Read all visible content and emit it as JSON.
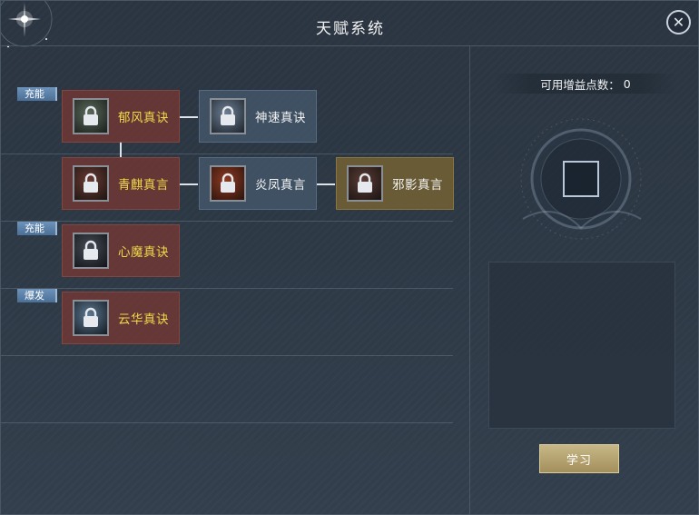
{
  "window": {
    "title": "天赋系统"
  },
  "tags": [
    {
      "label": "充能"
    },
    {
      "label": "充能"
    },
    {
      "label": "爆发"
    }
  ],
  "nodes": [
    {
      "label": "郁风真诀",
      "style": "red",
      "icon": "wind-skill-icon"
    },
    {
      "label": "神速真诀",
      "style": "blue",
      "icon": "speed-skill-icon"
    },
    {
      "label": "青麒真言",
      "style": "red",
      "icon": "qilin-skill-icon"
    },
    {
      "label": "炎凤真言",
      "style": "blue",
      "icon": "phoenix-skill-icon"
    },
    {
      "label": "邪影真言",
      "style": "gold",
      "icon": "shadow-skill-icon"
    },
    {
      "label": "心魔真诀",
      "style": "red",
      "icon": "demon-skill-icon"
    },
    {
      "label": "云华真诀",
      "style": "red",
      "icon": "cloud-skill-icon"
    }
  ],
  "side": {
    "points_label": "可用增益点数：",
    "points_value": "0",
    "learn_label": "学习"
  },
  "colors": {
    "accent_gold": "#f0d84a",
    "tag_blue": "#5b80a8",
    "button_gold": "#b8a571"
  }
}
